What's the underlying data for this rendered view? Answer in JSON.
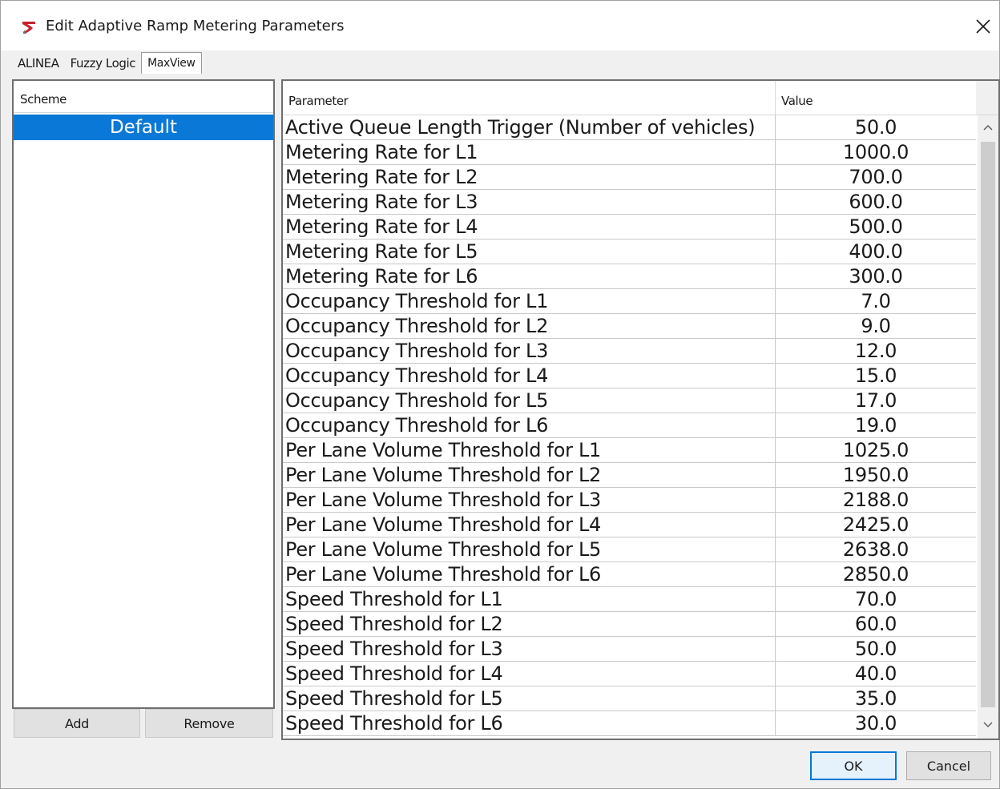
{
  "window": {
    "title": "Edit Adaptive Ramp Metering Parameters",
    "app_icon": "app-logo-icon",
    "close_icon": "close-icon",
    "accent_color": "#0a78d7",
    "logo_color": "#c8232c"
  },
  "tabs": [
    {
      "label": "ALINEA",
      "active": false
    },
    {
      "label": "Fuzzy Logic",
      "active": false
    },
    {
      "label": "MaxView",
      "active": true
    }
  ],
  "schemes": {
    "header": "Scheme",
    "items": [
      {
        "label": "Default",
        "selected": true
      }
    ],
    "add_label": "Add",
    "remove_label": "Remove"
  },
  "table": {
    "columns": [
      "Parameter",
      "Value"
    ],
    "rows": [
      {
        "param": "Active Queue Length Trigger (Number of vehicles)",
        "value": "50.0"
      },
      {
        "param": "Metering Rate for L1",
        "value": "1000.0"
      },
      {
        "param": "Metering Rate for L2",
        "value": "700.0"
      },
      {
        "param": "Metering Rate for L3",
        "value": "600.0"
      },
      {
        "param": "Metering Rate for L4",
        "value": "500.0"
      },
      {
        "param": "Metering Rate for L5",
        "value": "400.0"
      },
      {
        "param": "Metering Rate for L6",
        "value": "300.0"
      },
      {
        "param": "Occupancy Threshold for L1",
        "value": "7.0"
      },
      {
        "param": "Occupancy Threshold for L2",
        "value": "9.0"
      },
      {
        "param": "Occupancy Threshold for L3",
        "value": "12.0"
      },
      {
        "param": "Occupancy Threshold for L4",
        "value": "15.0"
      },
      {
        "param": "Occupancy Threshold for L5",
        "value": "17.0"
      },
      {
        "param": "Occupancy Threshold for L6",
        "value": "19.0"
      },
      {
        "param": "Per Lane Volume Threshold for L1",
        "value": "1025.0"
      },
      {
        "param": "Per Lane Volume Threshold for L2",
        "value": "1950.0"
      },
      {
        "param": "Per Lane Volume Threshold for L3",
        "value": "2188.0"
      },
      {
        "param": "Per Lane Volume Threshold for L4",
        "value": "2425.0"
      },
      {
        "param": "Per Lane Volume Threshold for L5",
        "value": "2638.0"
      },
      {
        "param": "Per Lane Volume Threshold for L6",
        "value": "2850.0"
      },
      {
        "param": "Speed Threshold for L1",
        "value": "70.0"
      },
      {
        "param": "Speed Threshold for L2",
        "value": "60.0"
      },
      {
        "param": "Speed Threshold for L3",
        "value": "50.0"
      },
      {
        "param": "Speed Threshold for L4",
        "value": "40.0"
      },
      {
        "param": "Speed Threshold for L5",
        "value": "35.0"
      },
      {
        "param": "Speed Threshold for L6",
        "value": "30.0"
      }
    ]
  },
  "footer": {
    "ok_label": "OK",
    "cancel_label": "Cancel"
  }
}
